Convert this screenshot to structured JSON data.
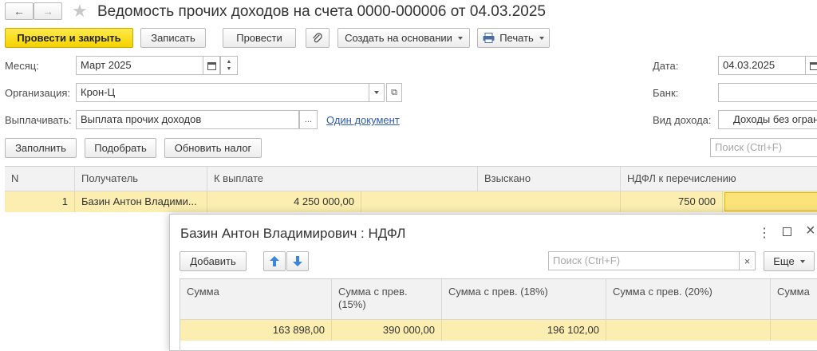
{
  "window": {
    "title": "Ведомость прочих доходов на счета 0000-000006 от 04.03.2025"
  },
  "toolbar": {
    "post_close": "Провести и закрыть",
    "save": "Записать",
    "post": "Провести",
    "create_based": "Создать на основании",
    "print": "Печать"
  },
  "form": {
    "month_label": "Месяц:",
    "month_value": "Март 2025",
    "org_label": "Организация:",
    "org_value": "Крон-Ц",
    "pay_label": "Выплачивать:",
    "pay_value": "Выплата прочих доходов",
    "pay_link": "Один документ",
    "date_label": "Дата:",
    "date_value": "04.03.2025",
    "bank_label": "Банк:",
    "bank_value": "",
    "income_type_label": "Вид дохода:",
    "income_type_value": "Доходы без ограни"
  },
  "actions": {
    "fill": "Заполнить",
    "select": "Подобрать",
    "update_tax": "Обновить налог",
    "search_placeholder": "Поиск (Ctrl+F)"
  },
  "table": {
    "headers": [
      "N",
      "Получатель",
      "К выплате",
      "Взыскано",
      "НДФЛ к перечислению"
    ],
    "rows": [
      {
        "n": "1",
        "recipient": "Базин Антон Владими...",
        "to_pay": "4 250 000,00",
        "collected": "",
        "ndfl": "750 000"
      }
    ]
  },
  "dialog": {
    "title": "Базин Антон Владимирович : НДФЛ",
    "add": "Добавить",
    "search_placeholder": "Поиск (Ctrl+F)",
    "more": "Еще",
    "headers": [
      "Сумма",
      "Сумма с прев. (15%)",
      "Сумма с прев. (18%)",
      "Сумма с прев. (20%)",
      "Сумма"
    ],
    "row": [
      "163 898,00",
      "390 000,00",
      "196 102,00",
      "",
      ""
    ]
  },
  "colors": {
    "accent_yellow": "#f5d300",
    "row_highlight": "#fbeeb0",
    "link": "#2e5ca8",
    "arrow_red": "#e0262b",
    "nav_blue": "#3b86d6"
  }
}
